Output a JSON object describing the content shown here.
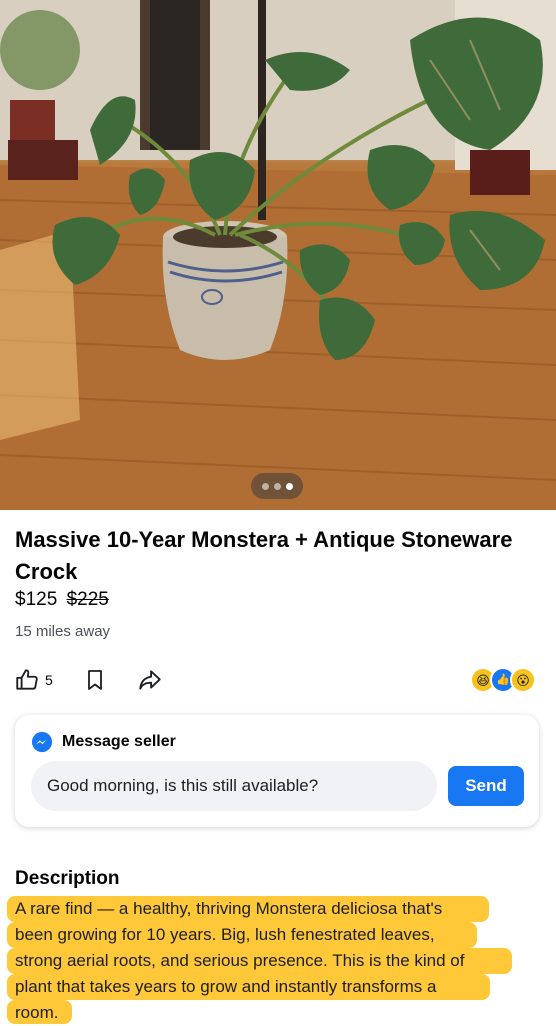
{
  "listing": {
    "title": "Massive 10-Year Monstera + Antique Stoneware Crock",
    "price": "$125",
    "original_price": "$225",
    "distance": "15 miles away",
    "photo_count": 3,
    "active_photo_index": 3
  },
  "actions": {
    "like_count": "5",
    "icons": [
      "thumbs-up-icon",
      "bookmark-icon",
      "share-icon"
    ],
    "reactions": [
      "haha-reaction",
      "like-reaction",
      "wow-reaction"
    ]
  },
  "message": {
    "header": "Message seller",
    "input_value": "Good morning, is this still available?",
    "send_label": "Send"
  },
  "description": {
    "heading": "Description",
    "lines": [
      "A rare find — a healthy, thriving Monstera deliciosa that's",
      "been growing for 10 years. Big, lush fenestrated leaves,",
      "strong aerial roots, and serious presence. This is the kind of",
      "plant that takes years to grow and instantly transforms a",
      "room."
    ]
  },
  "colors": {
    "accent": "#1877f2",
    "highlight": "#ffb800",
    "input_bg": "#f0f2f5"
  }
}
